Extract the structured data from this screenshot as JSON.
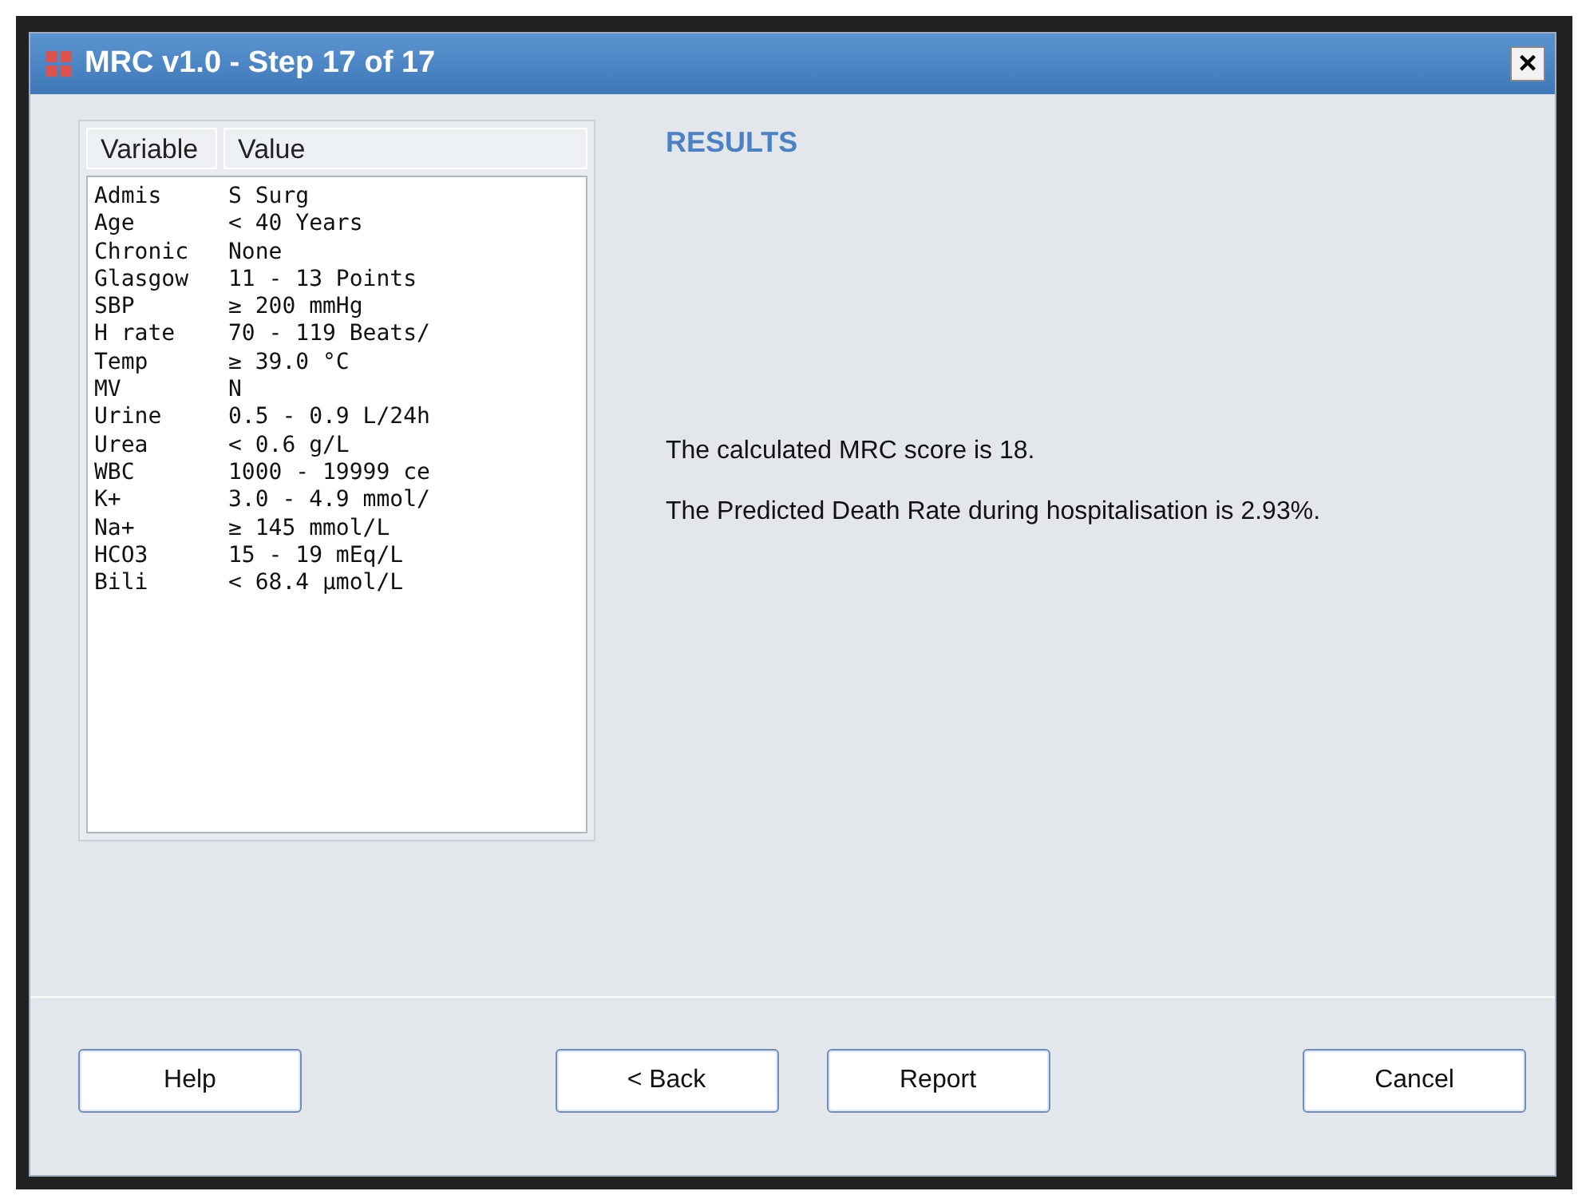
{
  "window": {
    "title": "MRC v1.0 - Step 17 of 17",
    "close": "×"
  },
  "table": {
    "columns": [
      "Variable",
      "Value"
    ],
    "rows": [
      {
        "variable": "Admis",
        "value": "S Surg"
      },
      {
        "variable": "Age",
        "value": "< 40 Years"
      },
      {
        "variable": "Chronic",
        "value": "None"
      },
      {
        "variable": "Glasgow",
        "value": "11 - 13 Points"
      },
      {
        "variable": "SBP",
        "value": "≥ 200 mmHg"
      },
      {
        "variable": "H rate",
        "value": "70 - 119 Beats/"
      },
      {
        "variable": "Temp",
        "value": "≥ 39.0 °C"
      },
      {
        "variable": "MV",
        "value": "N"
      },
      {
        "variable": "Urine",
        "value": "0.5 - 0.9 L/24h"
      },
      {
        "variable": "Urea",
        "value": "< 0.6 g/L"
      },
      {
        "variable": "WBC",
        "value": "1000 - 19999 ce"
      },
      {
        "variable": "K+",
        "value": "3.0 - 4.9 mmol/"
      },
      {
        "variable": "Na+",
        "value": "≥ 145 mmol/L"
      },
      {
        "variable": "HCO3",
        "value": "15 - 19 mEq/L"
      },
      {
        "variable": "Bili",
        "value": "< 68.4 µmol/L"
      }
    ]
  },
  "results": {
    "heading": "RESULTS",
    "paragraphs": [
      "The calculated MRC score is 18.",
      "The Predicted Death Rate during hospitalisation is 2.93%."
    ]
  },
  "buttons": {
    "left": [
      "Help"
    ],
    "center": [
      "< Back",
      "Report"
    ],
    "right": [
      "Cancel"
    ]
  }
}
